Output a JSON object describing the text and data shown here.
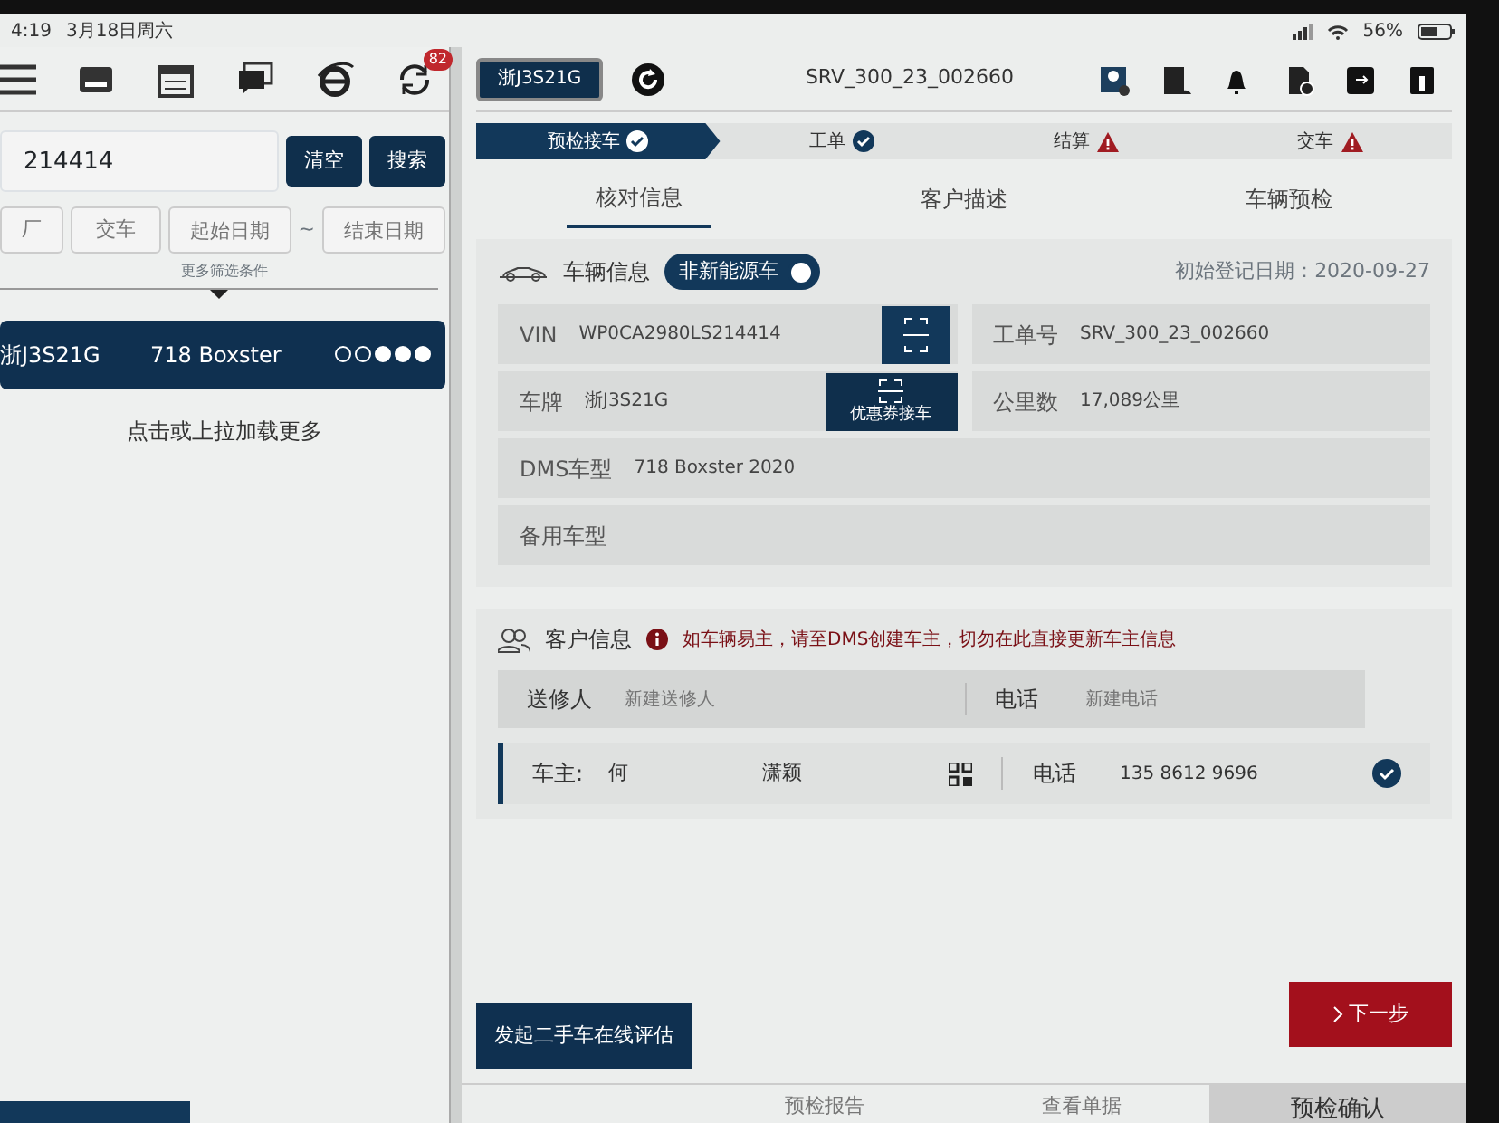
{
  "status_bar": {
    "time": "4:19",
    "date": "3月18日周六",
    "battery": "56%"
  },
  "left_toolbar": {
    "sync_badge": "82"
  },
  "search": {
    "value": "214414",
    "buttons": [
      "清空",
      "搜索"
    ]
  },
  "filters": [
    {
      "kind": "chip",
      "text": "厂"
    },
    {
      "kind": "chip",
      "text": "交车"
    },
    {
      "kind": "date",
      "placeholder": "起始日期"
    },
    {
      "kind": "sep",
      "text": "~"
    },
    {
      "kind": "date",
      "placeholder": "结束日期"
    }
  ],
  "more_filters": "更多筛选条件",
  "results": [
    {
      "plate": "浙J3S21G",
      "model": "718 Boxster",
      "selected": true,
      "dots": [
        {
          "filled": false
        },
        {
          "filled": false
        },
        {
          "filled": true
        },
        {
          "filled": true
        },
        {
          "filled": true
        }
      ]
    }
  ],
  "load_more": "点击或上拉加载更多",
  "header": {
    "plate": "浙J3S21G",
    "order_no": "SRV_300_23_002660"
  },
  "steps": [
    {
      "label": "预检接车",
      "done": true,
      "selected": true
    },
    {
      "label": "工单",
      "done": true,
      "selected": false
    },
    {
      "label": "结算",
      "done": false,
      "selected": false
    },
    {
      "label": "交车",
      "done": false,
      "selected": false
    }
  ],
  "tabs": [
    {
      "label": "核对信息",
      "selected": true
    },
    {
      "label": "客户描述",
      "selected": false
    },
    {
      "label": "车辆预检",
      "selected": false
    }
  ],
  "vehicle": {
    "title": "车辆信息",
    "toggle": {
      "label": "非新能源车",
      "on": true
    },
    "registration": "初始登记日期：2020-09-27",
    "vin": {
      "label": "VIN",
      "value": "WP0CA2980LS214414"
    },
    "order": {
      "label": "工单号",
      "value": "SRV_300_23_002660"
    },
    "plate": {
      "label": "车牌",
      "value": "浙J3S21G"
    },
    "coupon_button": "优惠券接车",
    "mileage": {
      "label": "公里数",
      "value": "17,089公里"
    },
    "dms_model": {
      "label": "DMS车型",
      "value": "718 Boxster 2020"
    },
    "backup_model": {
      "label": "备用车型"
    }
  },
  "customer": {
    "title": "客户信息",
    "warning": "如车辆易主，请至DMS创建车主，切勿在此直接更新车主信息",
    "sender": {
      "label": "送修人",
      "placeholder": "新建送修人",
      "phone_label": "电话",
      "phone_placeholder": "新建电话"
    },
    "owner": {
      "label": "车主:",
      "surname": "何",
      "given_name": "潇颖",
      "phone_label": "电话",
      "phone": "135 8612 9696",
      "checked": true
    }
  },
  "actions": {
    "evaluate": "发起二手车在线评估",
    "next": "下一步"
  },
  "bottom_tabs": [
    {
      "label": "预检报告",
      "selected": false
    },
    {
      "label": "查看单据",
      "selected": false
    },
    {
      "label": "预检确认",
      "selected": true
    }
  ]
}
